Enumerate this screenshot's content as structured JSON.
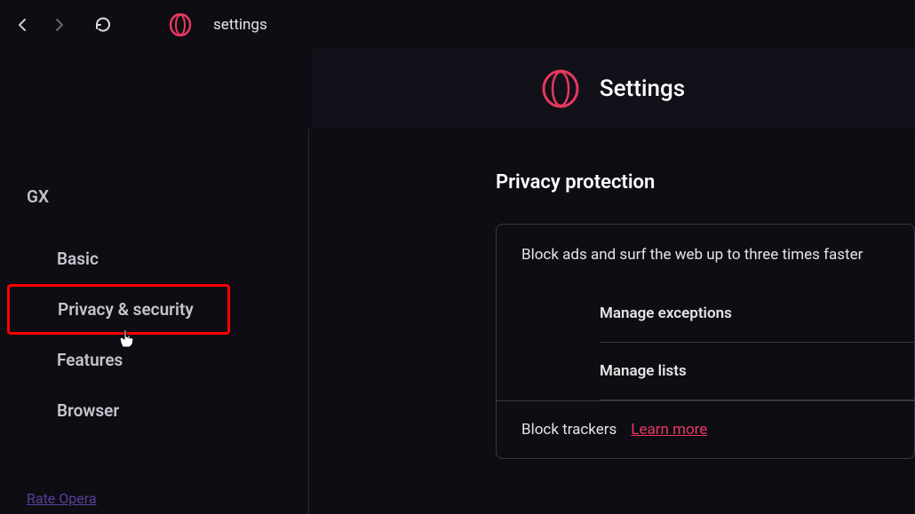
{
  "toolbar": {
    "url_text": "settings"
  },
  "header": {
    "title": "Settings"
  },
  "sidebar": {
    "heading": "GX",
    "items": [
      {
        "label": "Basic"
      },
      {
        "label": "Privacy & security"
      },
      {
        "label": "Features"
      },
      {
        "label": "Browser"
      }
    ],
    "rate_link": "Rate Opera"
  },
  "main": {
    "section_title": "Privacy protection",
    "block_ads_text": "Block ads and surf the web up to three times faster",
    "manage_exceptions": "Manage exceptions",
    "manage_lists": "Manage lists",
    "block_trackers": "Block trackers",
    "learn_more": "Learn more"
  },
  "colors": {
    "accent": "#e6385f"
  }
}
